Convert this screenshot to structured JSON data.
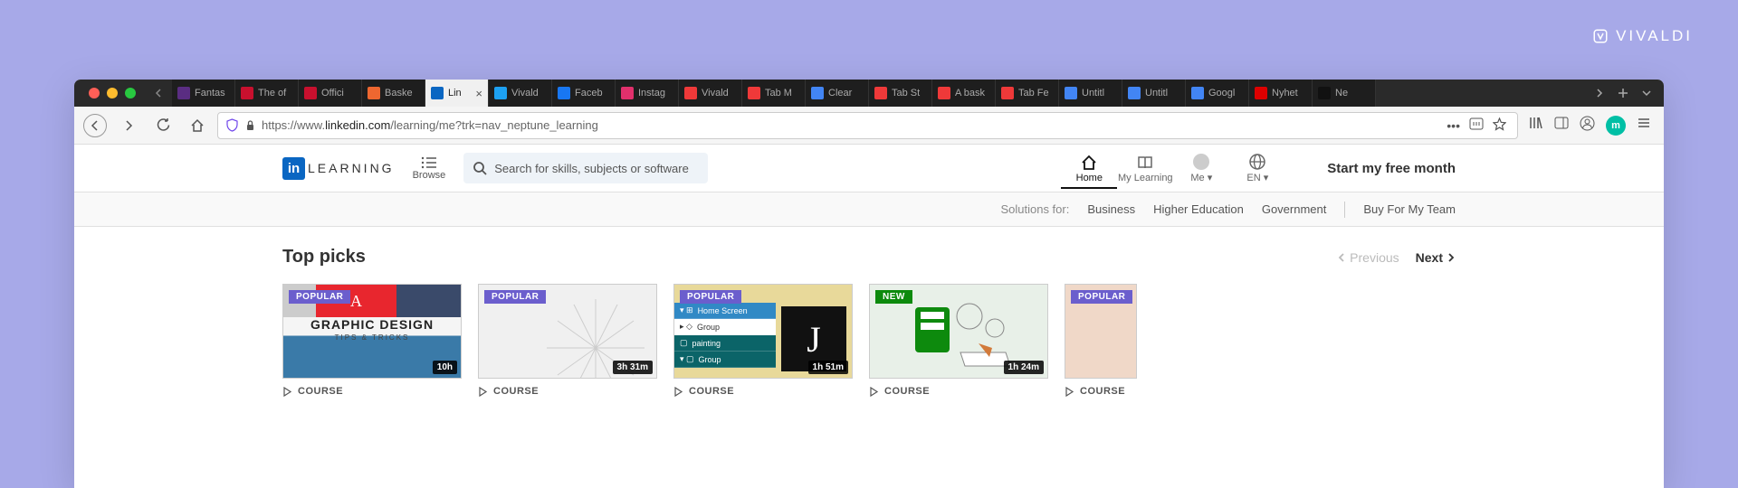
{
  "brand": "VIVALDI",
  "tabs": [
    {
      "label": "Fantas",
      "color": "#5a2d82"
    },
    {
      "label": "The of",
      "color": "#c8102e"
    },
    {
      "label": "Offici",
      "color": "#c8102e"
    },
    {
      "label": "Baske",
      "color": "#ee6730"
    },
    {
      "label": "Lin",
      "color": "#0a66c2",
      "active": true
    },
    {
      "label": "Vivald",
      "color": "#1da1f2"
    },
    {
      "label": "Faceb",
      "color": "#1877f2"
    },
    {
      "label": "Instag",
      "color": "#e1306c"
    },
    {
      "label": "Vivald",
      "color": "#ef3939"
    },
    {
      "label": "Tab M",
      "color": "#ef3939"
    },
    {
      "label": "Clear",
      "color": "#4285f4"
    },
    {
      "label": "Tab St",
      "color": "#ef3939"
    },
    {
      "label": "A bask",
      "color": "#ef3939"
    },
    {
      "label": "Tab Fe",
      "color": "#ef3939"
    },
    {
      "label": "Untitl",
      "color": "#4285f4"
    },
    {
      "label": "Untitl",
      "color": "#4285f4"
    },
    {
      "label": "Googl",
      "color": "#4285f4"
    },
    {
      "label": "Nyhet",
      "color": "#d00"
    },
    {
      "label": "Ne",
      "color": "#111"
    }
  ],
  "url": {
    "prefix": "https://www.",
    "domain": "linkedin.com",
    "path": "/learning/me?trk=nav_neptune_learning"
  },
  "user_initial": "m",
  "header": {
    "logo_in": "in",
    "logo_text": "LEARNING",
    "browse": "Browse",
    "search_placeholder": "Search for skills, subjects or software",
    "nav": [
      {
        "label": "Home",
        "active": true
      },
      {
        "label": "My Learning"
      },
      {
        "label": "Me"
      },
      {
        "label": "EN"
      }
    ],
    "cta": "Start my free month"
  },
  "subnav": {
    "label": "Solutions for:",
    "links": [
      "Business",
      "Higher Education",
      "Government"
    ],
    "buy": "Buy For My Team"
  },
  "section": {
    "title": "Top picks",
    "prev": "Previous",
    "next": "Next"
  },
  "cards": [
    {
      "badge": "POPULAR",
      "badge_type": "popular",
      "duration": "10h",
      "type": "COURSE",
      "thumb_title": "GRAPHIC DESIGN",
      "thumb_sub": "TIPS & TRICKS"
    },
    {
      "badge": "POPULAR",
      "badge_type": "popular",
      "duration": "3h 31m",
      "type": "COURSE"
    },
    {
      "badge": "POPULAR",
      "badge_type": "popular",
      "duration": "1h 51m",
      "type": "COURSE",
      "panel": [
        "Home Screen",
        "Group",
        "painting",
        "Group"
      ]
    },
    {
      "badge": "NEW",
      "badge_type": "new",
      "duration": "1h 24m",
      "type": "COURSE"
    },
    {
      "badge": "POPULAR",
      "badge_type": "popular",
      "duration": "",
      "type": "COURSE"
    }
  ]
}
